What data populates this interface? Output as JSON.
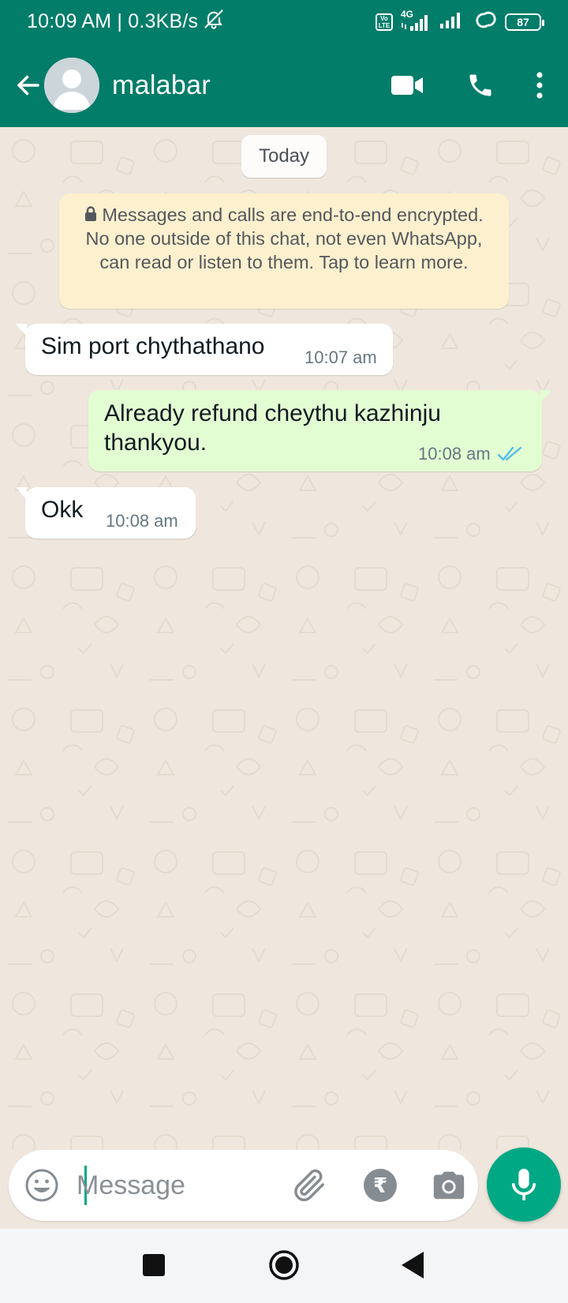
{
  "status_bar": {
    "time_speed": "10:09 AM | 0.3KB/s",
    "network": "4G",
    "volte_top": "Vo",
    "volte_bottom": "LTE",
    "battery": "87"
  },
  "header": {
    "contact_name": "malabar",
    "back_icon": "arrow-left-icon",
    "video_icon": "video-camera-icon",
    "call_icon": "phone-icon",
    "menu_icon": "more-vert-icon"
  },
  "chat": {
    "date_divider": "Today",
    "encryption_notice": "Messages and calls are end-to-end encrypted. No one outside of this chat, not even WhatsApp, can read or listen to them. Tap to learn more.",
    "messages": [
      {
        "direction": "incoming",
        "text": "Sim port chythathano",
        "time": "10:07 am"
      },
      {
        "direction": "outgoing",
        "text_line1": "Already refund cheythu kazhinju",
        "text_line2": "thankyou.",
        "time": "10:08 am",
        "status": "read"
      },
      {
        "direction": "incoming",
        "text": "Okk",
        "time": "10:08 am"
      }
    ]
  },
  "composer": {
    "placeholder": "Message",
    "value": "",
    "payment_symbol": "₹"
  },
  "colors": {
    "header_bg": "#017d69",
    "chat_bg": "#efe7dd",
    "outgoing_bubble": "#e3fdd3",
    "incoming_bubble": "#ffffff",
    "encryption_bg": "#fdf0cf",
    "accent": "#00a884",
    "read_ticks": "#53bdeb"
  }
}
